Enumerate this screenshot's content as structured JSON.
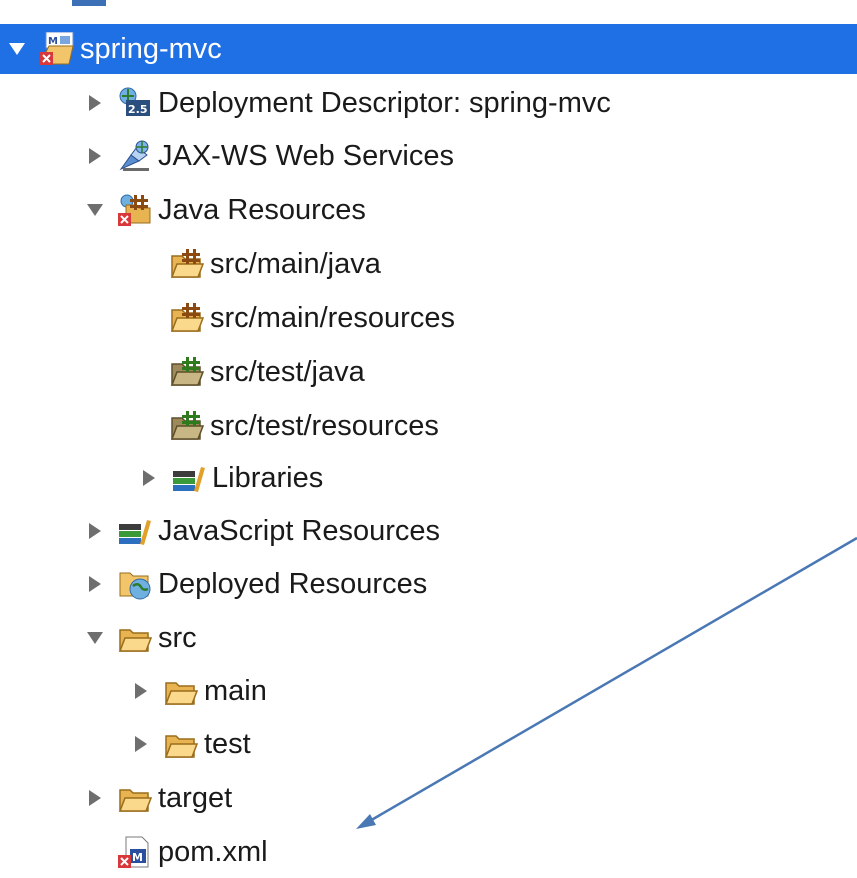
{
  "tree": {
    "items": [
      {
        "label": "spring-mvc",
        "icon": "maven-web-project-icon",
        "expanded": true,
        "selected": true
      },
      {
        "label": "Deployment Descriptor: spring-mvc",
        "icon": "deployment-descriptor-icon",
        "expanded": false
      },
      {
        "label": "JAX-WS Web Services",
        "icon": "web-services-icon",
        "expanded": false
      },
      {
        "label": "Java Resources",
        "icon": "java-resources-icon",
        "expanded": true
      },
      {
        "label": "src/main/java",
        "icon": "source-folder-icon"
      },
      {
        "label": "src/main/resources",
        "icon": "source-folder-icon"
      },
      {
        "label": "src/test/java",
        "icon": "test-source-folder-icon"
      },
      {
        "label": "src/test/resources",
        "icon": "test-source-folder-icon"
      },
      {
        "label": "Libraries",
        "icon": "libraries-icon",
        "expanded": false
      },
      {
        "label": "JavaScript Resources",
        "icon": "libraries-icon",
        "expanded": false
      },
      {
        "label": "Deployed Resources",
        "icon": "deployed-resources-icon",
        "expanded": false
      },
      {
        "label": "src",
        "icon": "folder-icon",
        "expanded": true
      },
      {
        "label": "main",
        "icon": "folder-icon",
        "expanded": false
      },
      {
        "label": "test",
        "icon": "folder-icon",
        "expanded": false
      },
      {
        "label": "target",
        "icon": "folder-icon",
        "expanded": false
      },
      {
        "label": "pom.xml",
        "icon": "maven-pom-file-icon"
      }
    ]
  },
  "colors": {
    "selection": "#1f6fe5",
    "annotation_arrow": "#4a78b5",
    "folder": "#f3c56a",
    "error_badge": "#d9383a"
  }
}
